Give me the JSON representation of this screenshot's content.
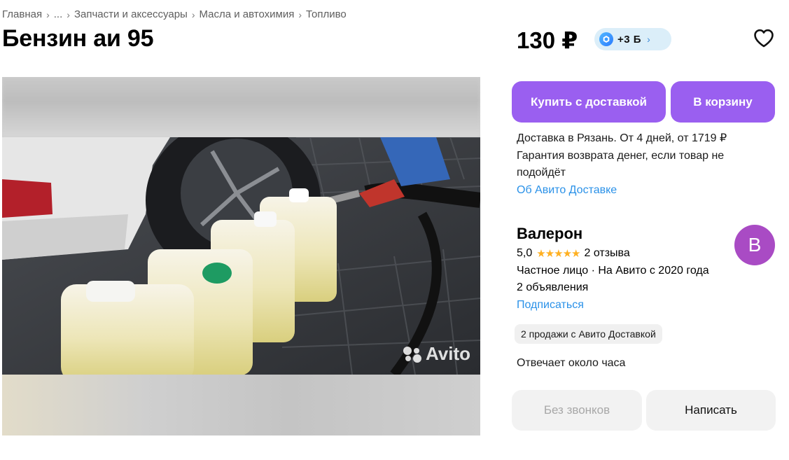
{
  "breadcrumbs": {
    "items": [
      "Главная",
      "...",
      "Запчасти и аксессуары",
      "Масла и автохимия",
      "Топливо"
    ],
    "separator": "›"
  },
  "listing": {
    "title": "Бензин аи 95",
    "price": "130 ₽",
    "bonus": {
      "label": "+3 Б",
      "chevron": "›",
      "icon": "bonus-coin-icon"
    },
    "favorite_icon": "heart-outline-icon"
  },
  "gallery": {
    "watermark": "Avito"
  },
  "actions": {
    "buy_label": "Купить с доставкой",
    "cart_label": "В корзину"
  },
  "delivery": {
    "line1": "Доставка в Рязань. От 4 дней, от 1719 ₽",
    "line2": "Гарантия возврата денег, если товар не подойдёт",
    "link": "Об Авито Доставке"
  },
  "seller": {
    "name": "Валерон",
    "rating": "5,0",
    "stars": "★★★★★",
    "reviews": "2 отзыва",
    "type": "Частное лицо · На Авито с 2020 года",
    "ads": "2 объявления",
    "subscribe": "Подписаться",
    "avatar_letter": "В",
    "sales_badge": "2 продажи с Авито Доставкой",
    "response_time": "Отвечает около часа"
  },
  "contact": {
    "no_calls_label": "Без звонков",
    "write_label": "Написать"
  },
  "colors": {
    "accent": "#9a5ff0",
    "link": "#2a91e8",
    "avatar": "#a94bc4",
    "stars": "#ffb021",
    "bonus_bg": "#dbeef9"
  }
}
